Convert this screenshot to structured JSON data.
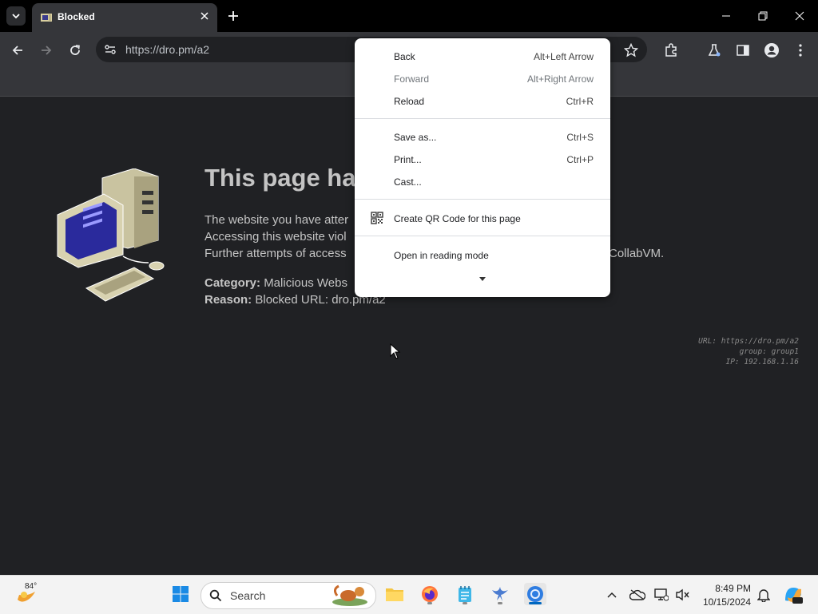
{
  "browser": {
    "tab": {
      "title": "Blocked"
    },
    "omnibox": {
      "url": "https://dro.pm/a2"
    }
  },
  "page": {
    "headline": "This page ha",
    "body_lines": [
      "The website you have atter",
      "Accessing this website viol",
      "Further attempts of access",
      "CollabVM."
    ],
    "category": {
      "label": "Category:",
      "value": "Malicious Webs"
    },
    "reason": {
      "label": "Reason:",
      "value": "Blocked URL: dro.pm/a2"
    },
    "stamp": {
      "url": "URL: https://dro.pm/a2",
      "group": "group: group1",
      "ip": "IP: 192.168.1.16"
    }
  },
  "context_menu": {
    "items": [
      {
        "label": "Back",
        "shortcut": "Alt+Left Arrow",
        "disabled": false
      },
      {
        "label": "Forward",
        "shortcut": "Alt+Right Arrow",
        "disabled": true
      },
      {
        "label": "Reload",
        "shortcut": "Ctrl+R",
        "disabled": false
      },
      {
        "label": "Save as...",
        "shortcut": "Ctrl+S",
        "disabled": false
      },
      {
        "label": "Print...",
        "shortcut": "Ctrl+P",
        "disabled": false
      },
      {
        "label": "Cast...",
        "shortcut": "",
        "disabled": false
      },
      {
        "label": "Create QR Code for this page",
        "shortcut": "",
        "disabled": false
      },
      {
        "label": "Open in reading mode",
        "shortcut": "",
        "disabled": false
      }
    ]
  },
  "taskbar": {
    "weather": {
      "temp": "84°"
    },
    "search": {
      "label": "Search"
    },
    "clock": {
      "time": "8:49 PM",
      "date": "10/15/2024"
    }
  },
  "colors": {
    "page_bg": "#202124",
    "menu_bg": "#ffffff",
    "accent": "#0067c0"
  }
}
